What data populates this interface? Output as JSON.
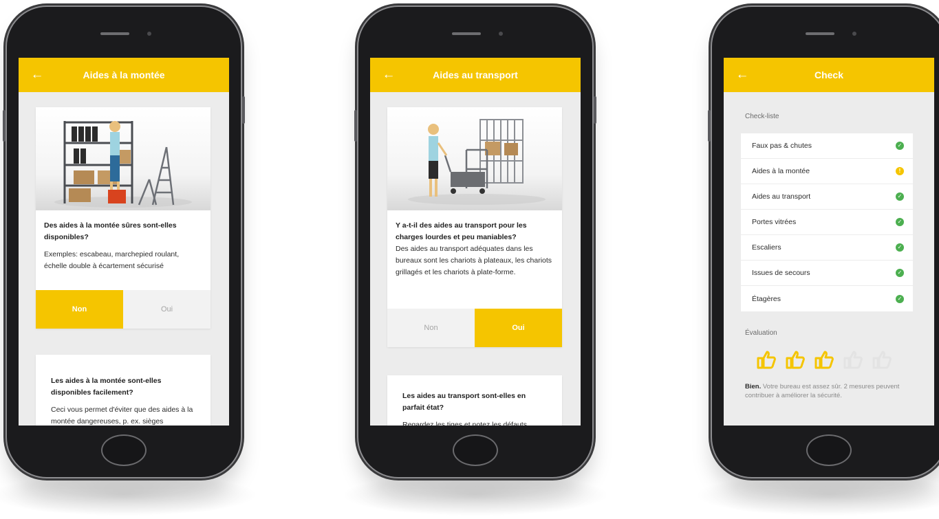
{
  "screens": [
    {
      "title": "Aides à la montée",
      "card1": {
        "question": "Des aides à la montée sûres sont-elles disponibles?",
        "description": "Exemples: escabeau, marchepied roulant, échelle double à écartement sécurisé",
        "selected": "Non"
      },
      "card2": {
        "question": "Les aides à la montée sont-elles disponibles facilement?",
        "description": "Ceci vous permet d'éviter que des aides à la montée dangereuses, p. ex. sièges"
      }
    },
    {
      "title": "Aides au transport",
      "card1": {
        "question": "Y a-t-il des aides au transport pour les charges lourdes et peu maniables?",
        "description": "Des aides au transport adéquates dans les bureaux sont les chariots à plateaux, les chariots grillagés et les chariots à plate-forme.",
        "selected": "Oui"
      },
      "card2": {
        "question": "Les aides au transport sont-elles en parfait état?",
        "description": "Regardez les tiges et notez les défauts"
      }
    },
    {
      "title": "Check",
      "checklist_label": "Check-liste",
      "items": [
        {
          "label": "Faux pas & chutes",
          "status": "ok"
        },
        {
          "label": "Aides à la montée",
          "status": "warning"
        },
        {
          "label": "Aides au transport",
          "status": "ok"
        },
        {
          "label": "Portes vitrées",
          "status": "ok"
        },
        {
          "label": "Escaliers",
          "status": "ok"
        },
        {
          "label": "Issues de secours",
          "status": "ok"
        },
        {
          "label": "Étagères",
          "status": "ok"
        }
      ],
      "evaluation_label": "Évaluation",
      "rating": {
        "value": 3,
        "max": 5
      },
      "evaluation_strong": "Bien.",
      "evaluation_text": "Votre bureau est assez sûr. 2 mesures peuvent contribuer à améliorer la sécurité."
    }
  ],
  "answers": {
    "no": "Non",
    "yes": "Oui"
  },
  "icons": {
    "back": "arrow-left-icon",
    "ok": "check-circle-icon",
    "warning": "exclamation-circle-icon",
    "rating": "thumbs-up-icon"
  },
  "colors": {
    "accent": "#f5c500",
    "ok": "#4caf50",
    "screen_bg": "#ececec",
    "inactive_thumb": "#e3e3e3"
  }
}
